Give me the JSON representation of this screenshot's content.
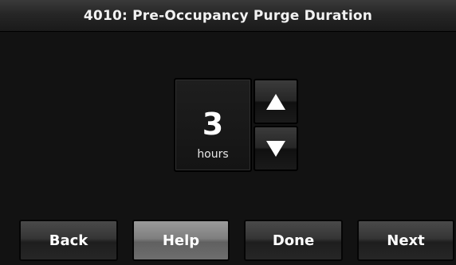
{
  "header": {
    "title": "4010: Pre-Occupancy Purge Duration"
  },
  "setting": {
    "value": "3",
    "unit": "hours"
  },
  "controls": {
    "increase_icon": "triangle-up",
    "decrease_icon": "triangle-down"
  },
  "footer": {
    "back_label": "Back",
    "help_label": "Help",
    "done_label": "Done",
    "next_label": "Next"
  },
  "colors": {
    "background": "#121212",
    "text": "#ffffff",
    "help_button": "#7f7f7f"
  }
}
